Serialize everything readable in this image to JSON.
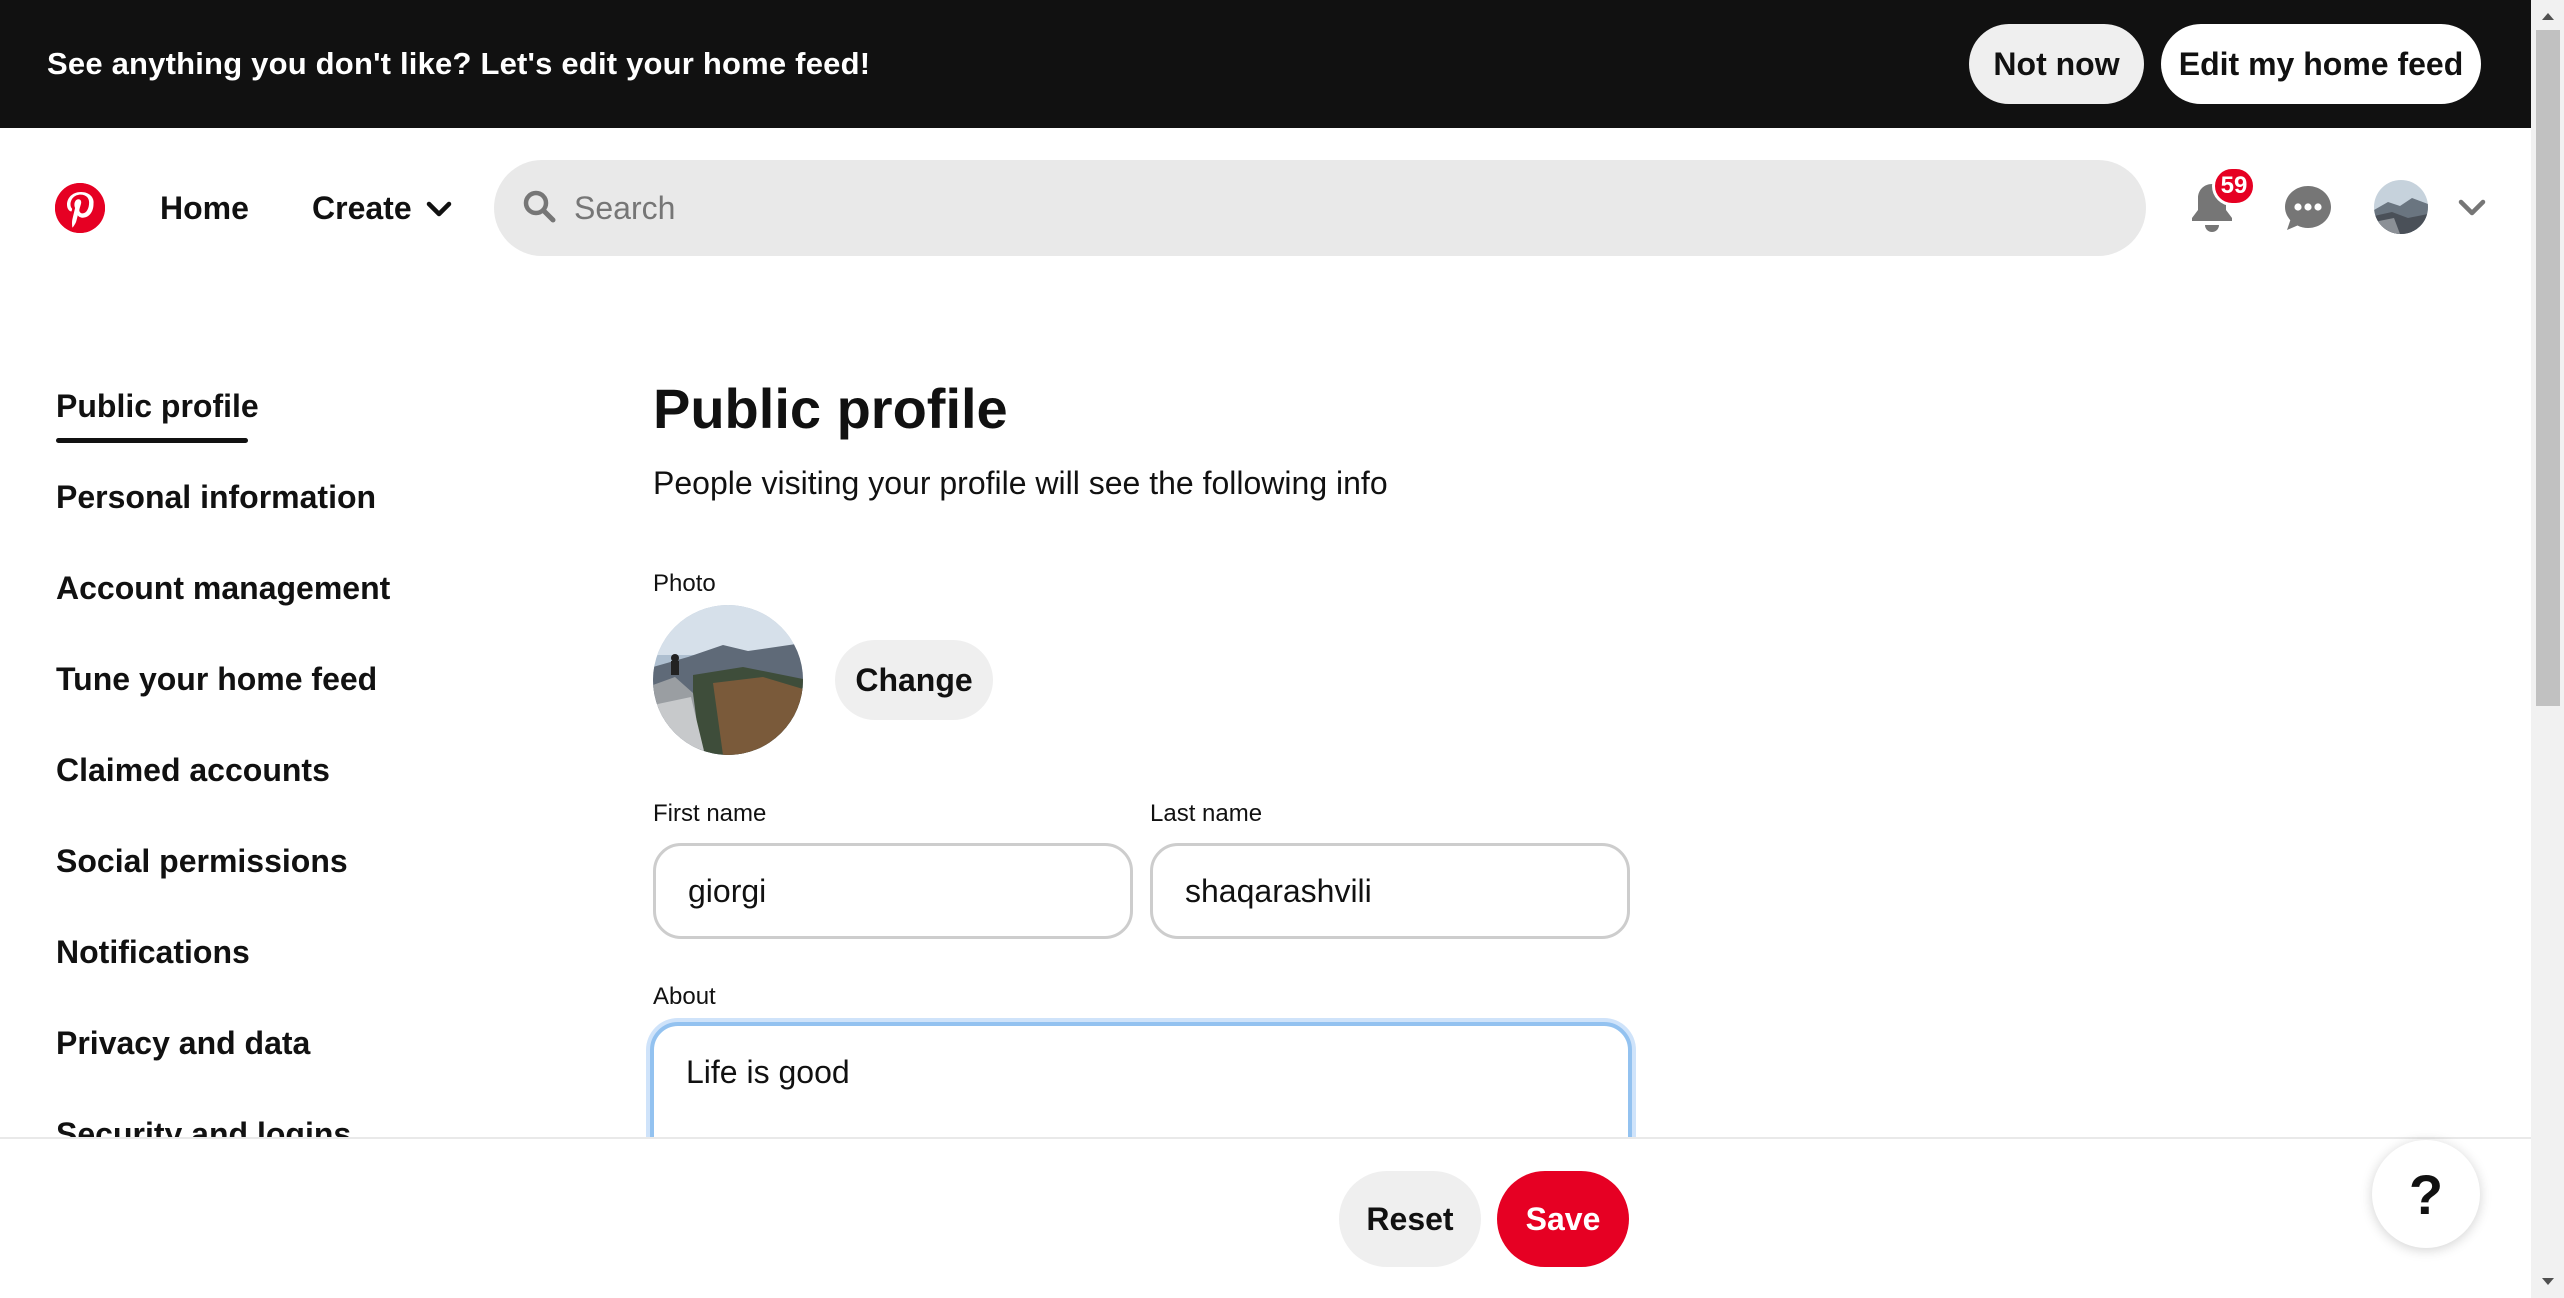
{
  "banner": {
    "message": "See anything you don't like? Let's edit your home feed!",
    "not_now_label": "Not now",
    "edit_feed_label": "Edit my home feed"
  },
  "header": {
    "home_label": "Home",
    "create_label": "Create",
    "search_placeholder": "Search",
    "notification_count": "59"
  },
  "sidebar": {
    "items": [
      {
        "label": "Public profile",
        "active": true
      },
      {
        "label": "Personal information"
      },
      {
        "label": "Account management"
      },
      {
        "label": "Tune your home feed"
      },
      {
        "label": "Claimed accounts"
      },
      {
        "label": "Social permissions"
      },
      {
        "label": "Notifications"
      },
      {
        "label": "Privacy and data"
      },
      {
        "label": "Security and logins"
      }
    ]
  },
  "main": {
    "title": "Public profile",
    "subtitle": "People visiting your profile will see the following info",
    "photo_label": "Photo",
    "change_label": "Change",
    "first_name_label": "First name",
    "first_name_value": "giorgi",
    "last_name_label": "Last name",
    "last_name_value": "shaqarashvili",
    "about_label": "About",
    "about_value": "Life is good"
  },
  "footer": {
    "reset_label": "Reset",
    "save_label": "Save",
    "help_label": "?"
  },
  "colors": {
    "brand_red": "#e60023",
    "banner_bg": "#111111",
    "button_gray": "#efefef",
    "focus_blue": "#93c2f0"
  }
}
